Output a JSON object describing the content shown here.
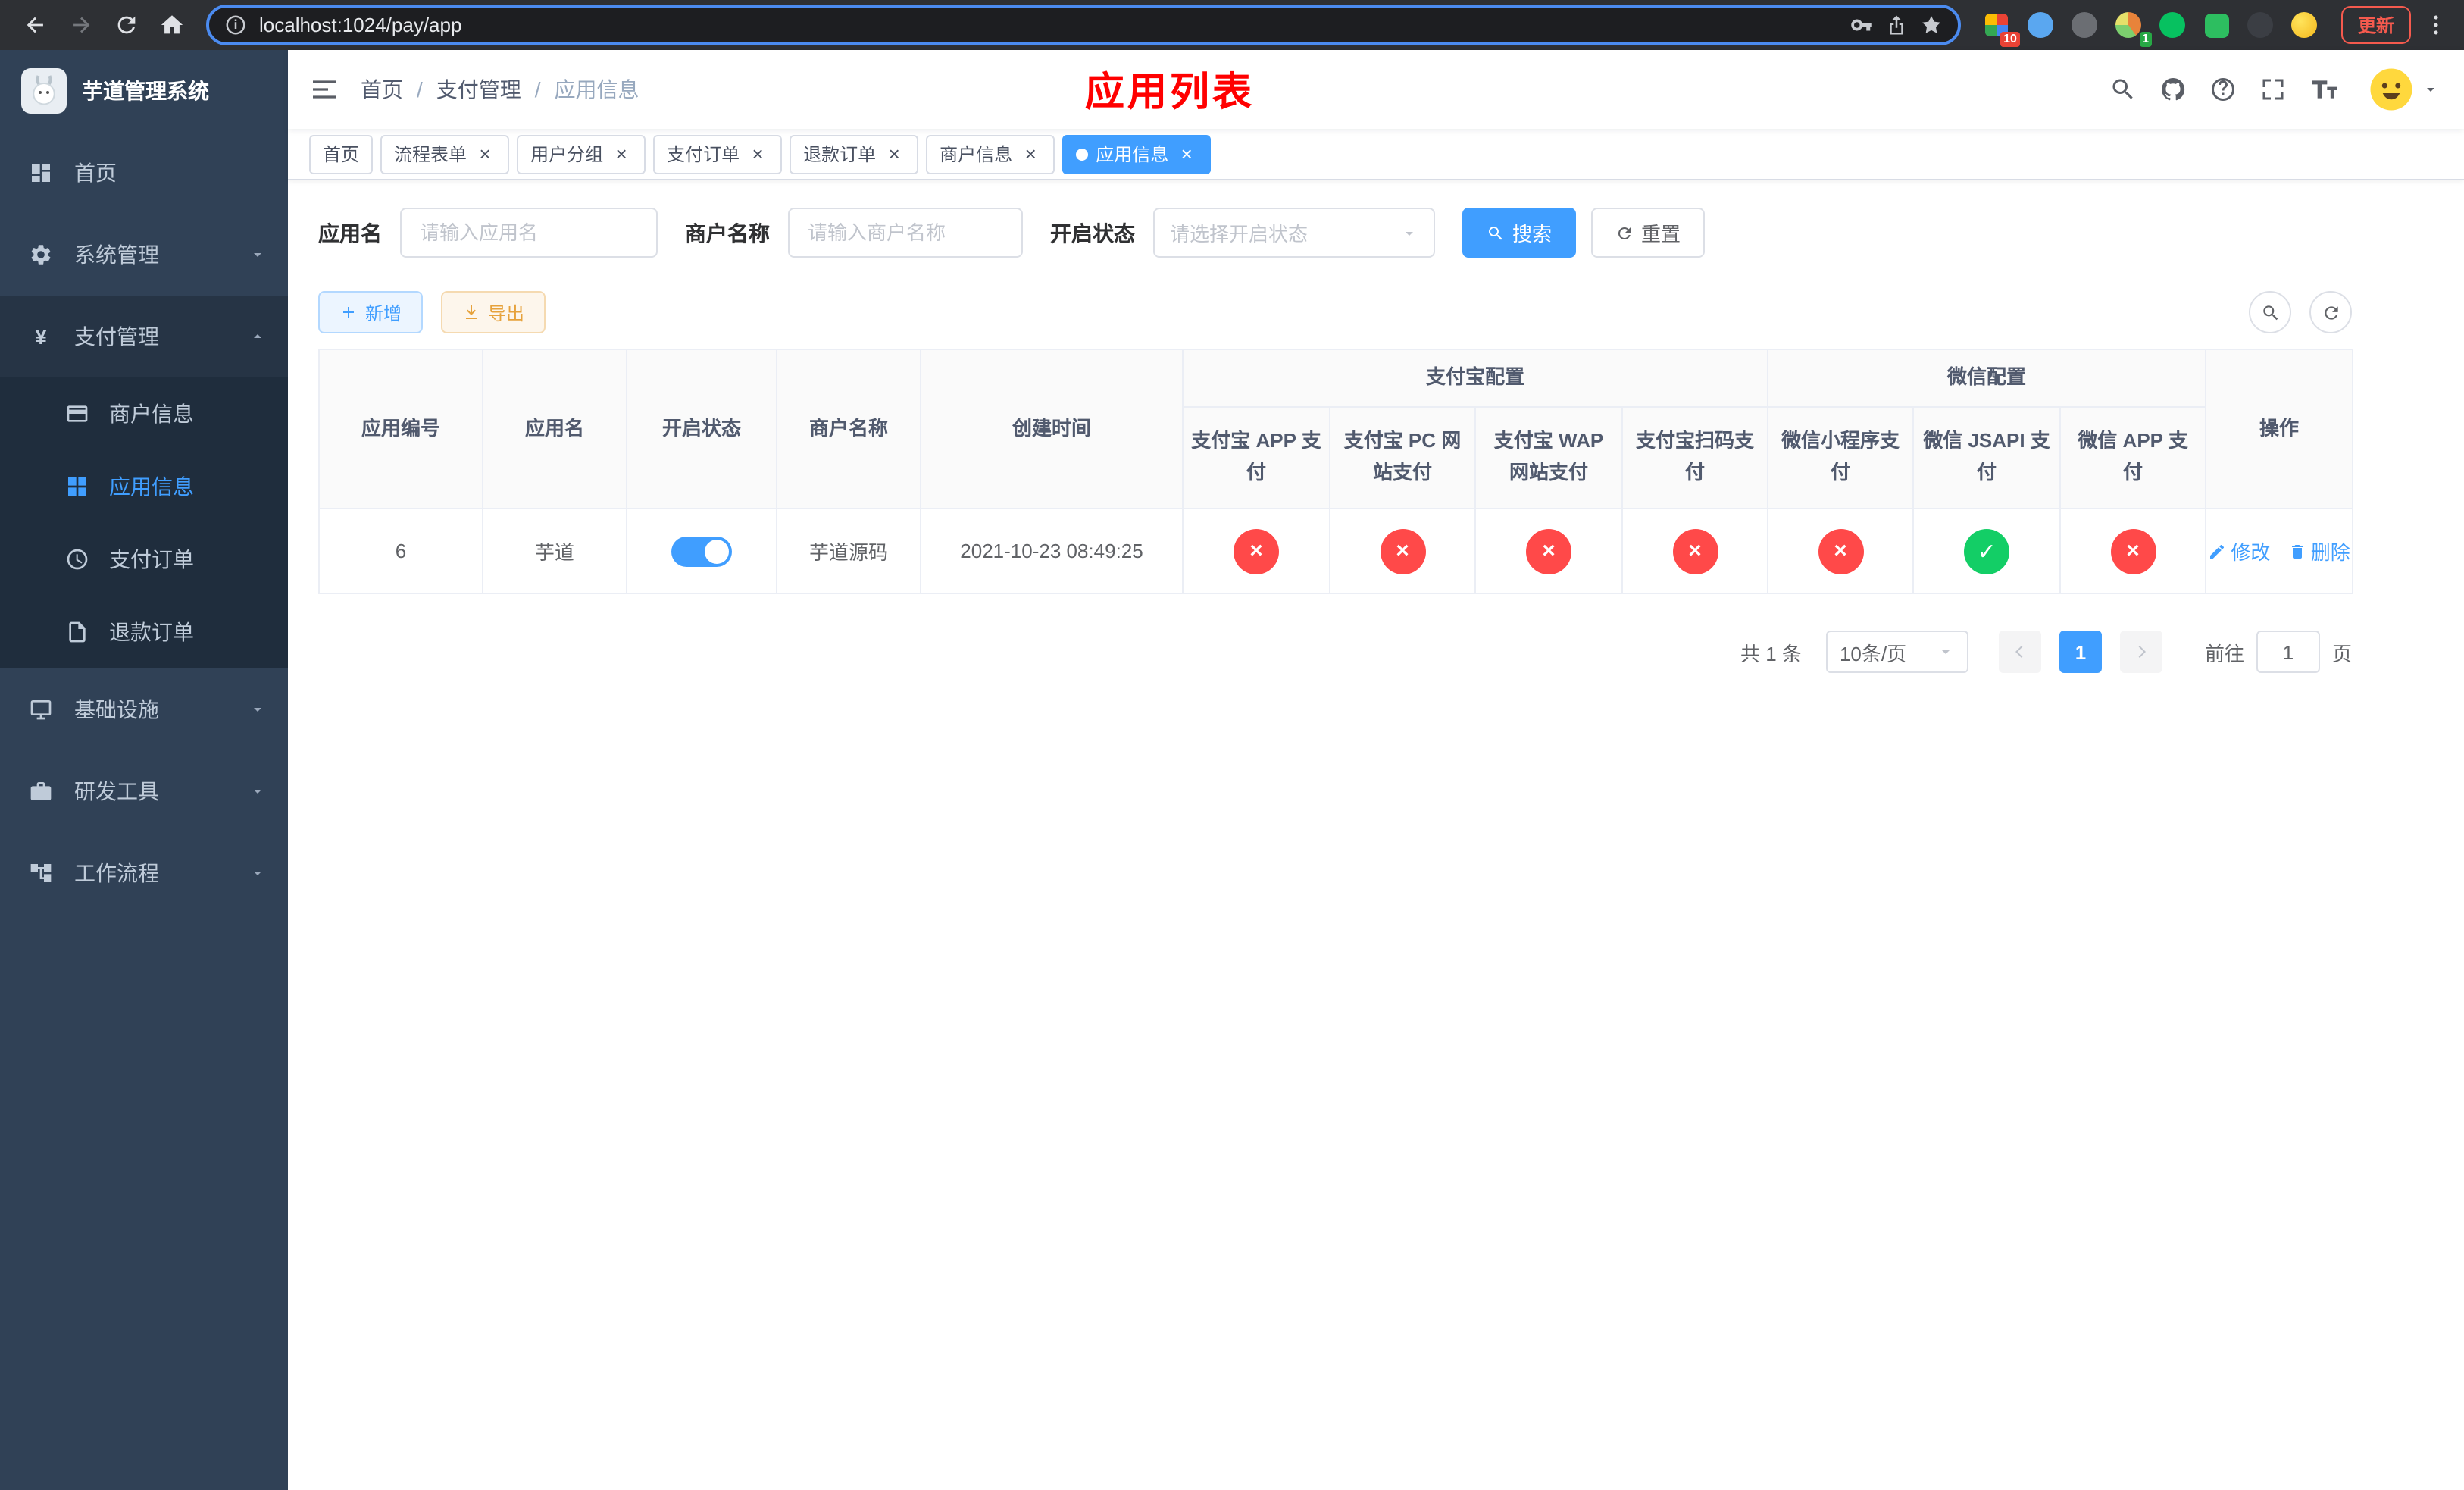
{
  "browser": {
    "url": "localhost:1024/pay/app",
    "update_button": "更新",
    "badges": {
      "extensions_red": "10",
      "extensions_green": "1"
    }
  },
  "sidebar": {
    "logo_title": "芋道管理系统",
    "menu": {
      "home": "首页",
      "system": "系统管理",
      "payment": "支付管理",
      "infrastructure": "基础设施",
      "devtools": "研发工具",
      "workflow": "工作流程"
    },
    "payment_submenu": {
      "merchant_info": "商户信息",
      "app_info": "应用信息",
      "pay_order": "支付订单",
      "refund_order": "退款订单"
    }
  },
  "header": {
    "breadcrumb": [
      "首页",
      "支付管理",
      "应用信息"
    ],
    "page_title": "应用列表"
  },
  "tabs": [
    {
      "label": "首页"
    },
    {
      "label": "流程表单"
    },
    {
      "label": "用户分组"
    },
    {
      "label": "支付订单"
    },
    {
      "label": "退款订单"
    },
    {
      "label": "商户信息"
    },
    {
      "label": "应用信息"
    }
  ],
  "filter": {
    "app_name_label": "应用名",
    "app_name_placeholder": "请输入应用名",
    "merchant_label": "商户名称",
    "merchant_placeholder": "请输入商户名称",
    "status_label": "开启状态",
    "status_placeholder": "请选择开启状态",
    "search_button": "搜索",
    "reset_button": "重置"
  },
  "toolbar": {
    "add_button": "新增",
    "export_button": "导出"
  },
  "table": {
    "columns": [
      "应用编号",
      "应用名",
      "开启状态",
      "商户名称",
      "创建时间"
    ],
    "alipay_group": {
      "title": "支付宝配置",
      "columns": [
        "支付宝 APP 支付",
        "支付宝 PC 网站支付",
        "支付宝 WAP 网站支付",
        "支付宝扫码支付"
      ]
    },
    "wechat_group": {
      "title": "微信配置",
      "columns": [
        "微信小程序支付",
        "微信 JSAPI 支付",
        "微信 APP 支付"
      ]
    },
    "actions_column": "操作",
    "rows": [
      {
        "app_id": "6",
        "app_name": "芋道",
        "enabled": true,
        "merchant_name": "芋道源码",
        "created_at": "2021-10-23 08:49:25",
        "alipay_app": "disabled",
        "alipay_pc": "disabled",
        "alipay_wap": "disabled",
        "alipay_qr": "disabled",
        "wechat_mini": "disabled",
        "wechat_jsapi": "enabled",
        "wechat_app": "disabled",
        "edit_label": "修改",
        "delete_label": "删除"
      }
    ]
  },
  "pagination": {
    "total_text": "共 1 条",
    "page_size_text": "10条/页",
    "current_page": "1",
    "goto_label": "前往",
    "goto_value": "1",
    "goto_unit": "页"
  },
  "colors": {
    "accent_blue": "#409eff",
    "danger_red": "#ff4949",
    "success_green": "#13ce66",
    "warning_orange": "#e6a23c",
    "sidebar_bg": "#304156",
    "submenu_bg": "#1f2d3d",
    "page_title_red": "#ff0000"
  }
}
